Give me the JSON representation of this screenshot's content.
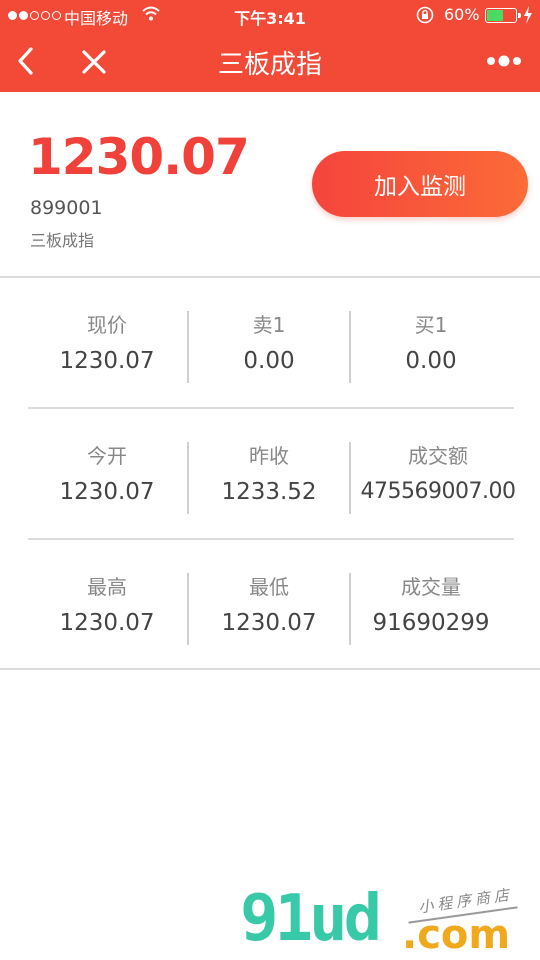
{
  "status_bar": {
    "carrier": "中国移动",
    "time": "下午3:41",
    "battery_percent": "60%",
    "battery_level": 0.6
  },
  "nav": {
    "title": "三板成指"
  },
  "index": {
    "price": "1230.07",
    "code": "899001",
    "name": "三板成指"
  },
  "monitor_button": {
    "label": "加入监测"
  },
  "quote_rows": [
    [
      {
        "label": "现价",
        "value": "1230.07"
      },
      {
        "label": "卖1",
        "value": "0.00"
      },
      {
        "label": "买1",
        "value": "0.00"
      }
    ],
    [
      {
        "label": "今开",
        "value": "1230.07"
      },
      {
        "label": "昨收",
        "value": "1233.52"
      },
      {
        "label": "成交额",
        "value": "475569007.00"
      }
    ],
    [
      {
        "label": "最高",
        "value": "1230.07"
      },
      {
        "label": "最低",
        "value": "1230.07"
      },
      {
        "label": "成交量",
        "value": "91690299"
      }
    ]
  ],
  "watermark": {
    "brand": "91ud",
    "domain": ".com",
    "tagline": "小程序商店"
  },
  "colors": {
    "header_red": "#f24a37",
    "price_red": "#f0413a",
    "button_gradient_start": "#f5443d",
    "button_gradient_end": "#fb6b37",
    "battery_green": "#4cd964"
  },
  "icons": [
    "signal-icon",
    "wifi-icon",
    "orientation-lock-icon",
    "battery-icon",
    "charging-icon",
    "back-chevron-icon",
    "close-icon",
    "more-dots-icon"
  ]
}
